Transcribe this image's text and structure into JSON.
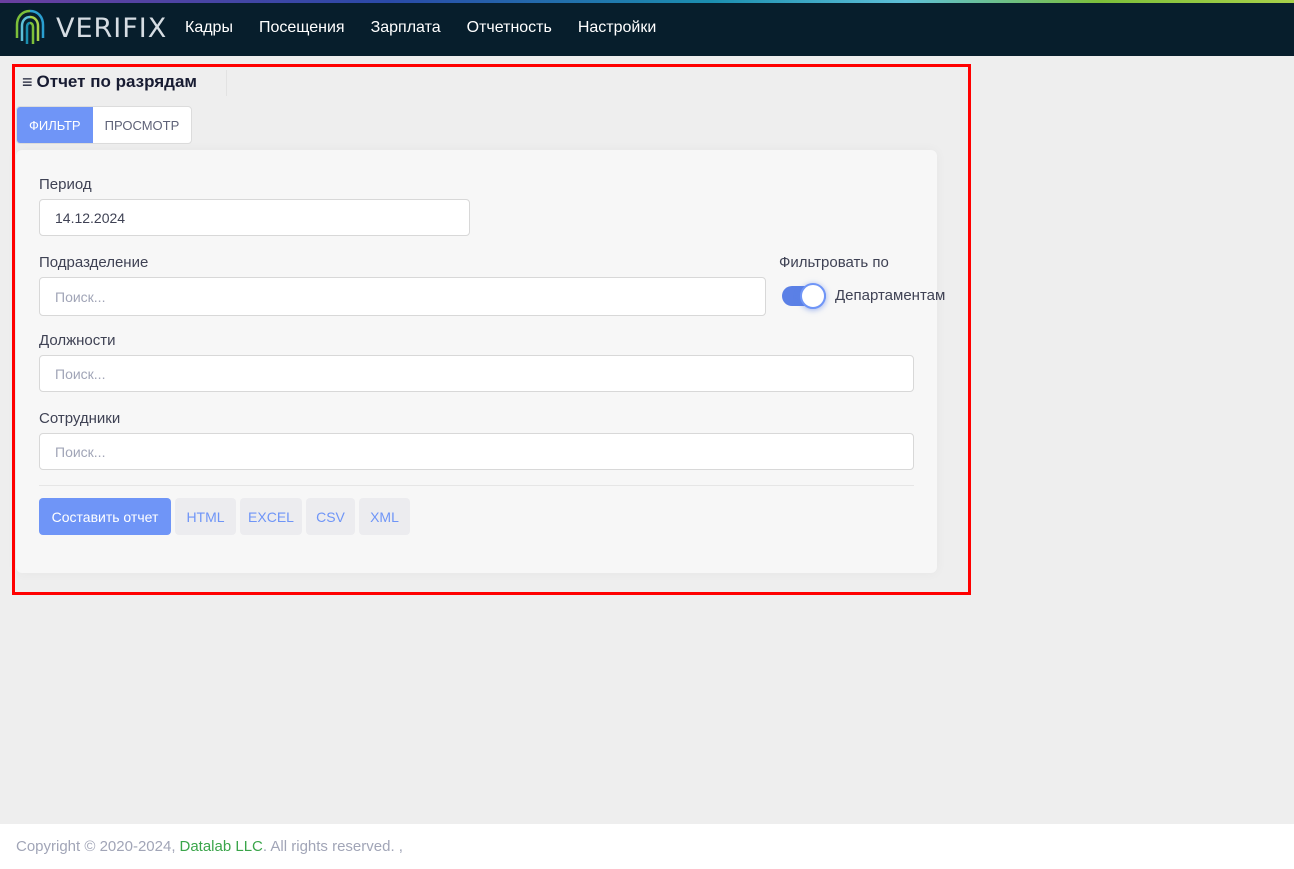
{
  "app": {
    "logo_text": "VERIFIX",
    "colors": {
      "nav_bg": "#071e2c",
      "primary": "#6f95f7",
      "highlight": "#ff0000",
      "footer_link": "#3aa54a"
    }
  },
  "nav": {
    "items": [
      {
        "label": "Кадры"
      },
      {
        "label": "Посещения"
      },
      {
        "label": "Зарплата"
      },
      {
        "label": "Отчетность"
      },
      {
        "label": "Настройки"
      }
    ]
  },
  "page": {
    "burger_icon": "≡",
    "title": "Отчет по разрядам"
  },
  "tabs": [
    {
      "label": "ФИЛЬТР",
      "active": true
    },
    {
      "label": "ПРОСМОТР",
      "active": false
    }
  ],
  "form": {
    "period": {
      "label": "Период",
      "value": "14.12.2024"
    },
    "department": {
      "label": "Подразделение",
      "placeholder": "Поиск..."
    },
    "filter_by": {
      "label": "Фильтровать по",
      "toggle_label": "Департаментам",
      "enabled": true
    },
    "positions": {
      "label": "Должности",
      "placeholder": "Поиск..."
    },
    "employees": {
      "label": "Сотрудники",
      "placeholder": "Поиск..."
    }
  },
  "actions": {
    "build_report": "Составить отчет",
    "html": "HTML",
    "excel": "EXCEL",
    "csv": "CSV",
    "xml": "XML"
  },
  "footer": {
    "copyright": "Copyright © 2020-2024,",
    "company": "Datalab LLC",
    "rights": ". All rights reserved. ,"
  }
}
